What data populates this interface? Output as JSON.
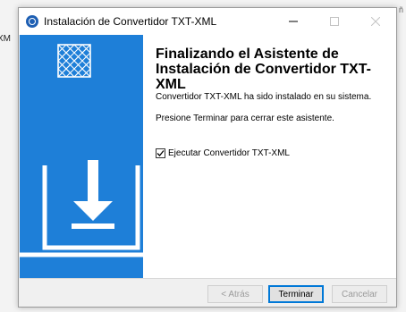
{
  "window": {
    "title": "Instalación de Convertidor TXT-XML"
  },
  "background": {
    "left_fragment": "XM",
    "right_fragment": "ñ"
  },
  "content": {
    "heading": "Finalizando el Asistente de Instalación de Convertidor TXT-XML",
    "installed_message": "Convertidor TXT-XML ha sido instalado en su sistema.",
    "finish_hint": "Presione Terminar para cerrar este asistente.",
    "run_checkbox": {
      "label": "Ejecutar Convertidor TXT-XML",
      "checked": true
    }
  },
  "buttons": {
    "back": "< Atrás",
    "finish": "Terminar",
    "cancel": "Cancelar"
  },
  "colors": {
    "banner": "#1e7fd8",
    "accent": "#0078d7"
  },
  "icons": {
    "app": "app-icon",
    "banner_logo": "installer-logo-icon",
    "banner_illustration": "laptop-download-icon",
    "minimize": "minimize-icon",
    "maximize": "maximize-icon",
    "close": "close-icon"
  }
}
